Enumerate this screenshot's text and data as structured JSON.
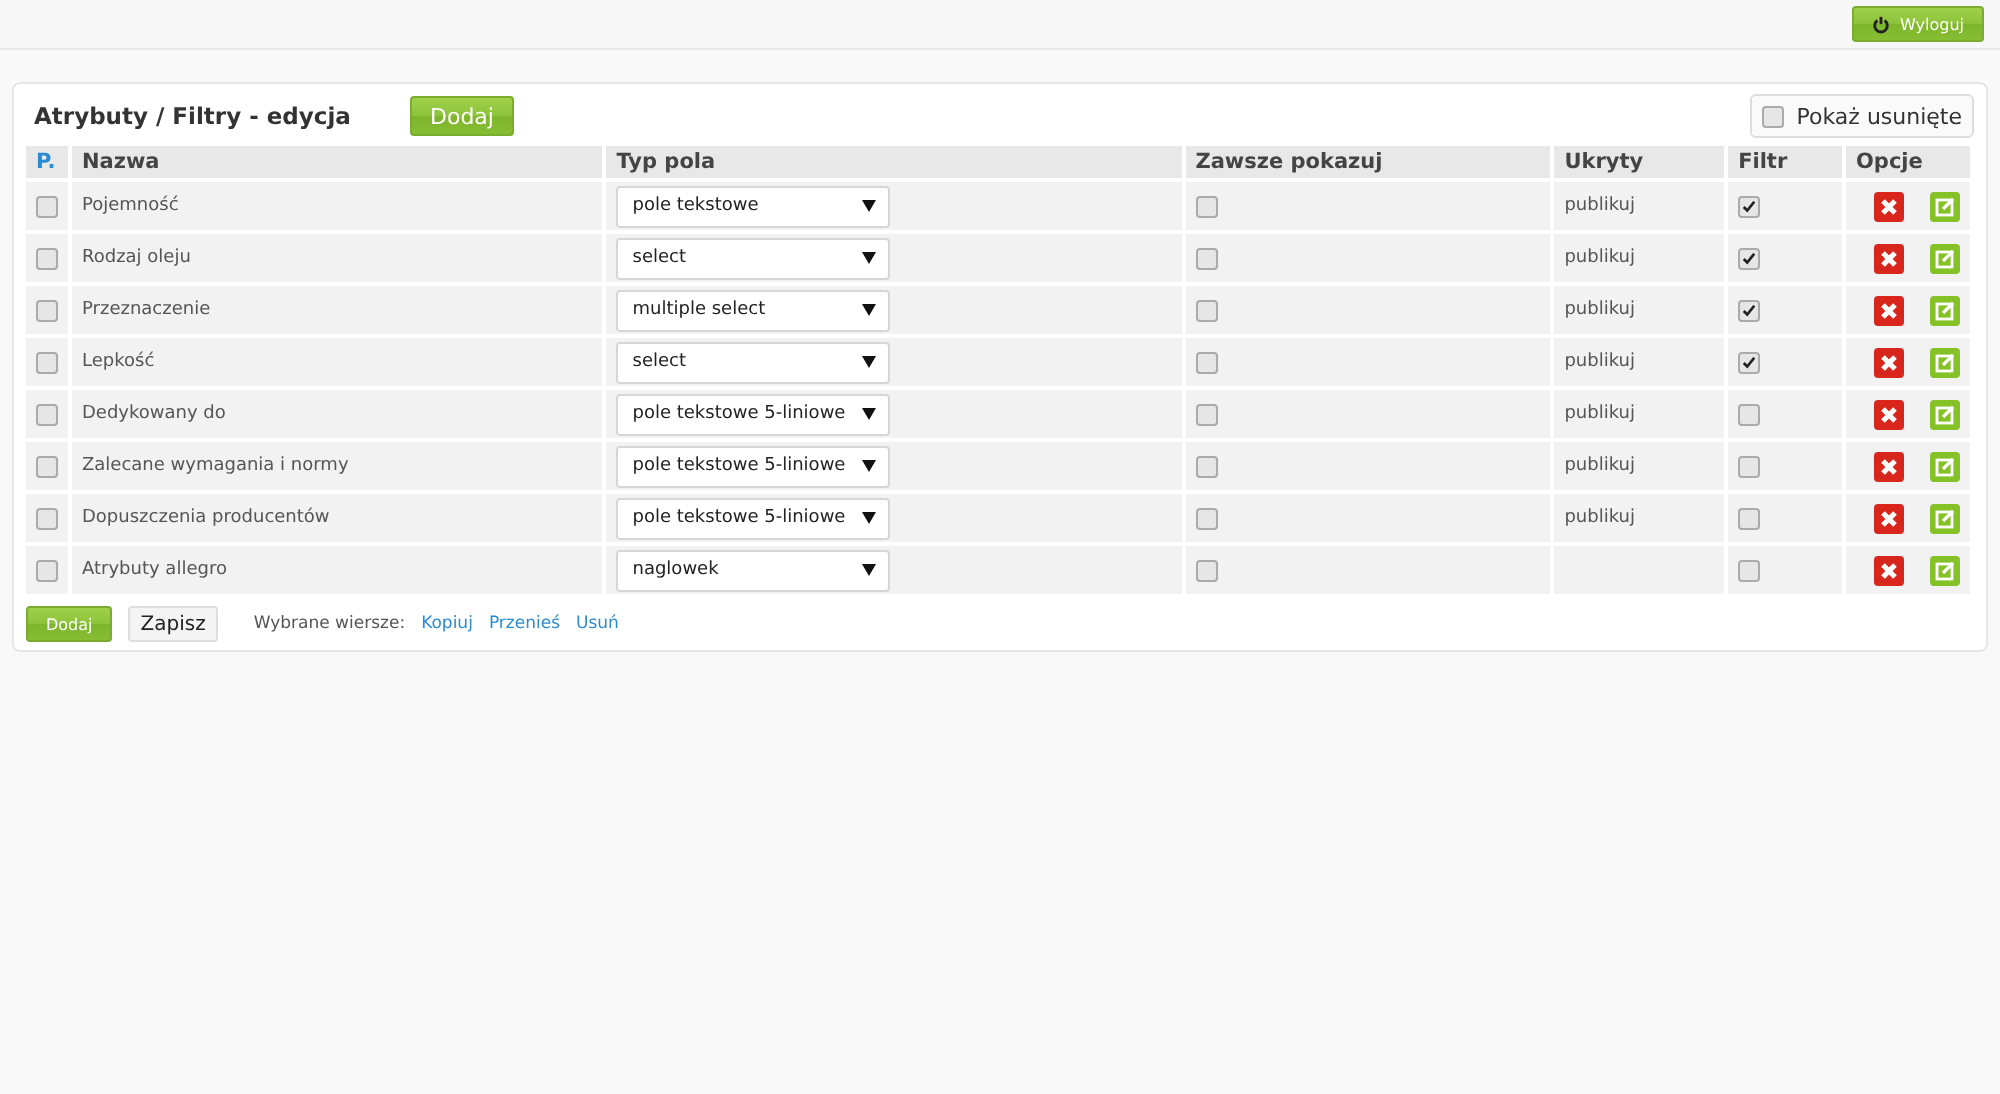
{
  "top_bar": {
    "logout_button": "Wyloguj"
  },
  "panel": {
    "title": "Atrybuty / Filtry - edycja",
    "add_button": "Dodaj",
    "show_deleted": {
      "label": "Pokaż usunięte",
      "checked": false
    }
  },
  "table": {
    "columns": [
      "P.",
      "Nazwa",
      "Typ pola",
      "Zawsze pokazuj",
      "Ukryty",
      "Filtr",
      "Opcje"
    ],
    "rows": [
      {
        "checked": false,
        "name": "Pojemność",
        "field_type": "pole tekstowe",
        "always_show": false,
        "hidden": "publikuj",
        "filter": true
      },
      {
        "checked": false,
        "name": "Rodzaj oleju",
        "field_type": "select",
        "always_show": false,
        "hidden": "publikuj",
        "filter": true
      },
      {
        "checked": false,
        "name": "Przeznaczenie",
        "field_type": "multiple select",
        "always_show": false,
        "hidden": "publikuj",
        "filter": true
      },
      {
        "checked": false,
        "name": "Lepkość",
        "field_type": "select",
        "always_show": false,
        "hidden": "publikuj",
        "filter": true
      },
      {
        "checked": false,
        "name": "Dedykowany do",
        "field_type": "pole tekstowe 5-liniowe",
        "always_show": false,
        "hidden": "publikuj",
        "filter": false
      },
      {
        "checked": false,
        "name": "Zalecane wymagania i normy",
        "field_type": "pole tekstowe 5-liniowe",
        "always_show": false,
        "hidden": "publikuj",
        "filter": false
      },
      {
        "checked": false,
        "name": "Dopuszczenia producentów",
        "field_type": "pole tekstowe 5-liniowe",
        "always_show": false,
        "hidden": "publikuj",
        "filter": false
      },
      {
        "checked": false,
        "name": "Atrybuty allegro",
        "field_type": "naglowek",
        "always_show": false,
        "filter": false
      }
    ]
  },
  "footer": {
    "add_button": "Dodaj",
    "save_button": "Zapisz",
    "selected_label": "Wybrane wiersze:",
    "links": [
      "Kopiuj",
      "Przenieś",
      "Usuń"
    ]
  }
}
